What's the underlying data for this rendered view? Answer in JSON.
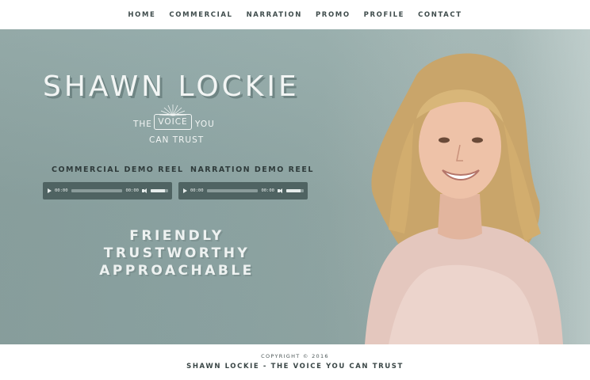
{
  "nav": {
    "items": [
      "HOME",
      "COMMERCIAL",
      "NARRATION",
      "PROMO",
      "PROFILE",
      "CONTACT"
    ]
  },
  "hero": {
    "title": "SHAWN LOCKIE",
    "logo": {
      "line1_left": "THE",
      "boxed": "VOICE",
      "line1_right": "YOU",
      "line2": "CAN TRUST"
    },
    "reels": [
      {
        "label": "COMMERCIAL DEMO REEL",
        "player": {
          "current": "00:00",
          "duration": "00:00",
          "progress": 0,
          "volume": 0.8
        }
      },
      {
        "label": "NARRATION DEMO REEL",
        "player": {
          "current": "00:00",
          "duration": "00:00",
          "progress": 0,
          "volume": 0.8
        }
      }
    ],
    "traits": [
      "FRIENDLY",
      "TRUSTWORTHY",
      "APPROACHABLE"
    ]
  },
  "footer": {
    "copyright": "COPYRIGHT © 2016",
    "tagline": "SHAWN LOCKIE - THE VOICE YOU CAN TRUST"
  },
  "colors": {
    "background": "#93aaa8",
    "player": "#4f6362",
    "nav_text": "#3f4c4c",
    "title_text": "#f2f5f4"
  },
  "icons": [
    "play-icon",
    "volume-icon",
    "sunburst-icon"
  ]
}
